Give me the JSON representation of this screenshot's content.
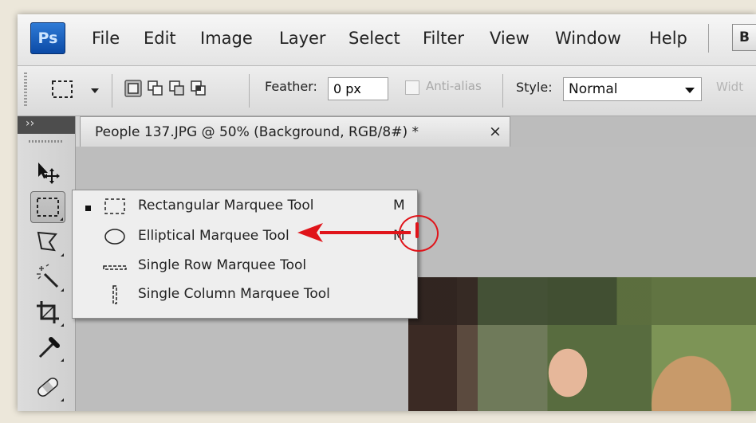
{
  "app": {
    "logo": "Ps",
    "menu": [
      "File",
      "Edit",
      "Image",
      "Layer",
      "Select",
      "Filter",
      "View",
      "Window",
      "Help"
    ],
    "bridge_button": "B"
  },
  "options_bar": {
    "feather_label": "Feather:",
    "feather_value": "0 px",
    "anti_alias_label": "Anti-alias",
    "anti_alias_checked": false,
    "style_label": "Style:",
    "style_value": "Normal",
    "width_label": "Widt"
  },
  "document": {
    "tab_title": "People 137.JPG @ 50% (Background, RGB/8#) *",
    "close_glyph": "×"
  },
  "toolbar": {
    "header_glyph": "››",
    "tools": [
      "move-tool",
      "rectangular-marquee-tool",
      "lasso-tool",
      "magic-wand-tool",
      "crop-tool",
      "eyedropper-tool",
      "healing-brush-tool"
    ]
  },
  "marquee_flyout": {
    "items": [
      {
        "label": "Rectangular Marquee Tool",
        "shortcut": "M",
        "selected": true,
        "icon": "rect-marquee-icon"
      },
      {
        "label": "Elliptical Marquee Tool",
        "shortcut": "M",
        "selected": false,
        "icon": "ellipse-marquee-icon"
      },
      {
        "label": "Single Row Marquee Tool",
        "shortcut": "",
        "selected": false,
        "icon": "single-row-icon"
      },
      {
        "label": "Single Column Marquee Tool",
        "shortcut": "",
        "selected": false,
        "icon": "single-column-icon"
      }
    ]
  },
  "annotation": {
    "color": "#e0141a"
  }
}
